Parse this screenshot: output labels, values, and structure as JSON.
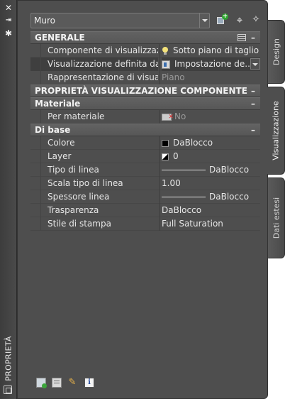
{
  "palette_title": "PROPRIETÀ",
  "object_type": "Muro",
  "tabs": [
    {
      "label": "Design"
    },
    {
      "label": "Visualizzazione"
    },
    {
      "label": "Dati estesi"
    }
  ],
  "sections": {
    "generale": {
      "title": "GENERALE",
      "rows": [
        {
          "key": "Componente di visualizzazi...",
          "value": "Sotto piano di taglio"
        },
        {
          "key": "Visualizzazione definita da",
          "value": "Impostazione de..."
        },
        {
          "key": "Rappresentazione di visuali...",
          "value": "Piano"
        }
      ]
    },
    "proprieta": {
      "title": "PROPRIETÀ VISUALIZZAZIONE COMPONENTE"
    },
    "materiale": {
      "title": "Materiale",
      "rows": [
        {
          "key": "Per materiale",
          "value": "No"
        }
      ]
    },
    "dibase": {
      "title": "Di base",
      "rows": [
        {
          "key": "Colore",
          "value": "DaBlocco"
        },
        {
          "key": "Layer",
          "value": "0"
        },
        {
          "key": "Tipo di linea",
          "value": "DaBlocco"
        },
        {
          "key": "Scala tipo di linea",
          "value": "1.00"
        },
        {
          "key": "Spessore linea",
          "value": "DaBlocco"
        },
        {
          "key": "Trasparenza",
          "value": "DaBlocco"
        },
        {
          "key": "Stile di stampa",
          "value": "Full Saturation"
        }
      ]
    }
  },
  "collapse_symbol": "–",
  "icons": {
    "close": "close-icon",
    "autohide": "autohide-icon",
    "settings": "gear-icon",
    "info_glyph": "i"
  },
  "colors": {
    "panel_bg": "#4e4e4e",
    "category_bg": "#5e5e5e",
    "text": "#e6e6e6",
    "dim_text": "#9a9a9a"
  }
}
